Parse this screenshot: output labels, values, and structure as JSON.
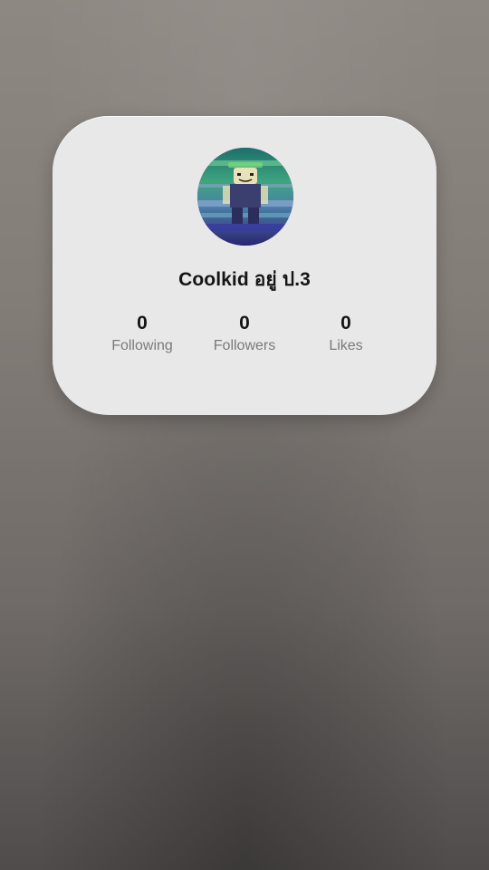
{
  "profile": {
    "display_name": "Coolkid อยู่ ป.3",
    "avatar_icon": "avatar-icon",
    "stats": [
      {
        "value": "0",
        "label": "Following"
      },
      {
        "value": "0",
        "label": "Followers"
      },
      {
        "value": "0",
        "label": "Likes"
      }
    ]
  },
  "colors": {
    "card_background": "#e8e8e8",
    "text_primary": "#151515",
    "text_secondary": "#7a7a7a"
  }
}
